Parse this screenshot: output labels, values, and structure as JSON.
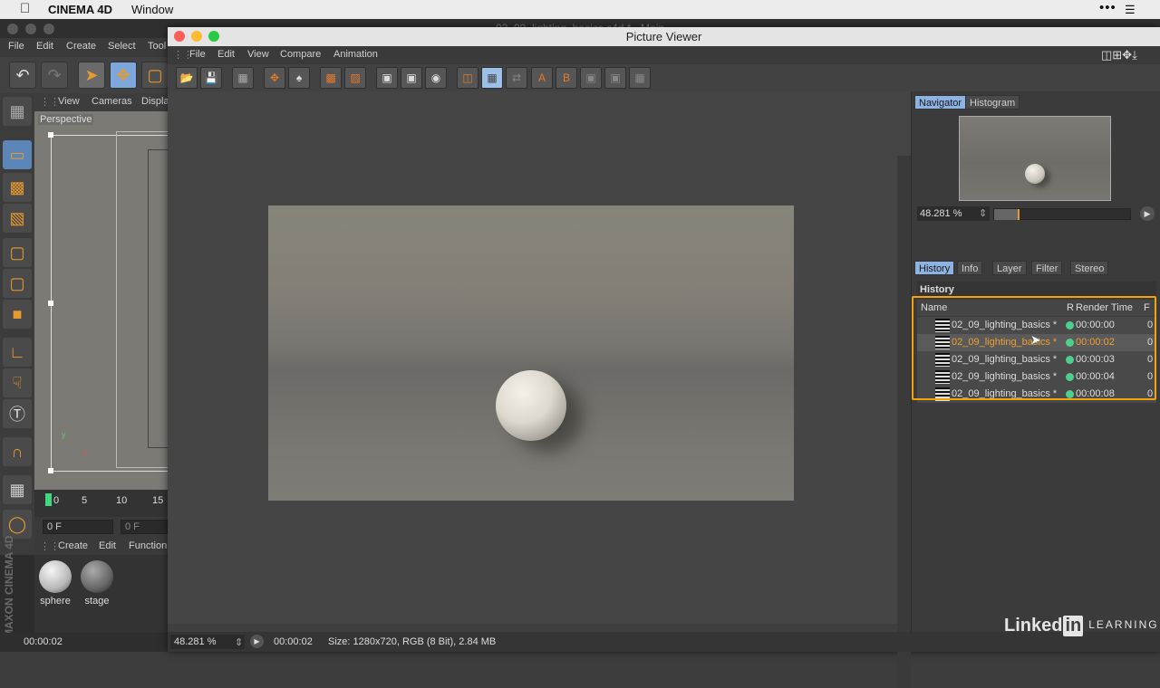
{
  "mac_menubar": {
    "app_name": "CINEMA 4D",
    "window_menu": "Window"
  },
  "c4d_main": {
    "window_title": "02_09_lighting_basics.c4d * - Main",
    "menu": [
      "File",
      "Edit",
      "Create",
      "Select",
      "Tool"
    ],
    "viewport": {
      "menu": [
        "View",
        "Cameras",
        "Displa"
      ],
      "label": "Perspective"
    },
    "timeline_ticks": [
      "0",
      "5",
      "10",
      "15"
    ],
    "frame_field_1": "0 F",
    "frame_field_2": "0 F",
    "material_menu": [
      "Create",
      "Edit",
      "Function"
    ],
    "materials": [
      {
        "name": "sphere"
      },
      {
        "name": "stage"
      }
    ],
    "status_time": "00:00:02",
    "maxon_text": "MAXON CINEMA 4D"
  },
  "picture_viewer": {
    "title": "Picture Viewer",
    "menu": [
      "File",
      "Edit",
      "View",
      "Compare",
      "Animation"
    ],
    "navigator_tabs": [
      "Navigator",
      "Histogram"
    ],
    "zoom_value": "48.281 %",
    "zoom_level": 0.17,
    "panel_tabs": [
      "History",
      "Info",
      "Layer",
      "Filter",
      "Stereo"
    ],
    "history_label": "History",
    "history_columns": {
      "name": "Name",
      "r": "R",
      "render_time": "Render Time",
      "f": "F"
    },
    "history_rows": [
      {
        "name": "02_09_lighting_basics *",
        "time": "00:00:00",
        "f": "0"
      },
      {
        "name": "02_09_lighting_basics *",
        "time": "00:00:02",
        "f": "0"
      },
      {
        "name": "02_09_lighting_basics *",
        "time": "00:00:03",
        "f": "0"
      },
      {
        "name": "02_09_lighting_basics *",
        "time": "00:00:04",
        "f": "0"
      },
      {
        "name": "02_09_lighting_basics *",
        "time": "00:00:08",
        "f": "0"
      }
    ],
    "status": {
      "zoom": "48.281 %",
      "time": "00:00:02",
      "info": "Size: 1280x720, RGB (8 Bit), 2.84 MB"
    }
  },
  "watermark": {
    "brand": "Linked",
    "in": "in",
    "learning": "LEARNING"
  },
  "colors": {
    "accent": "#f5a20f",
    "active_tab": "#8db3e2",
    "status_green": "#4fcf8c"
  }
}
